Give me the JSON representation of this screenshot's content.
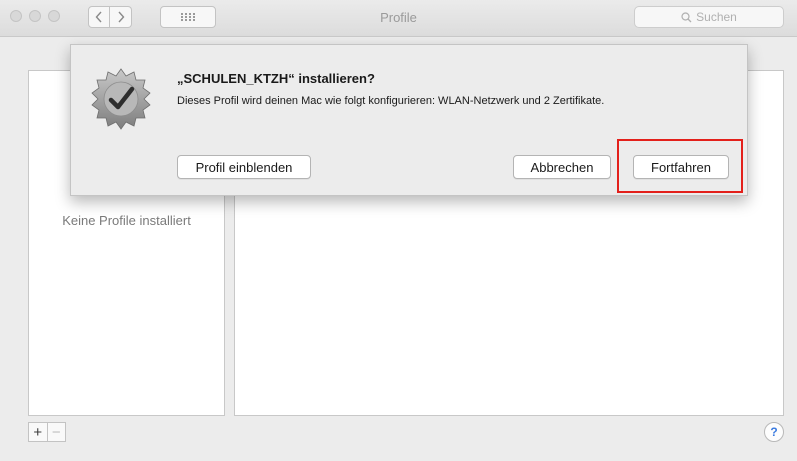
{
  "window": {
    "title": "Profile",
    "search": {
      "placeholder": "Suchen"
    }
  },
  "sidebar": {
    "empty_text": "Keine Profile installiert"
  },
  "dialog": {
    "title": "„SCHULEN_KTZH“ installieren?",
    "message": "Dieses Profil wird deinen Mac wie folgt konfigurieren: WLAN-Netzwerk und 2 Zertifikate.",
    "buttons": {
      "show_profile": "Profil einblenden",
      "cancel": "Abbrechen",
      "continue": "Fortfahren"
    },
    "icon": "certificate-check-icon"
  },
  "footer": {
    "add": "+",
    "remove": "−",
    "help": "?"
  },
  "colors": {
    "highlight": "#e3201b",
    "help_accent": "#3b7be0"
  }
}
